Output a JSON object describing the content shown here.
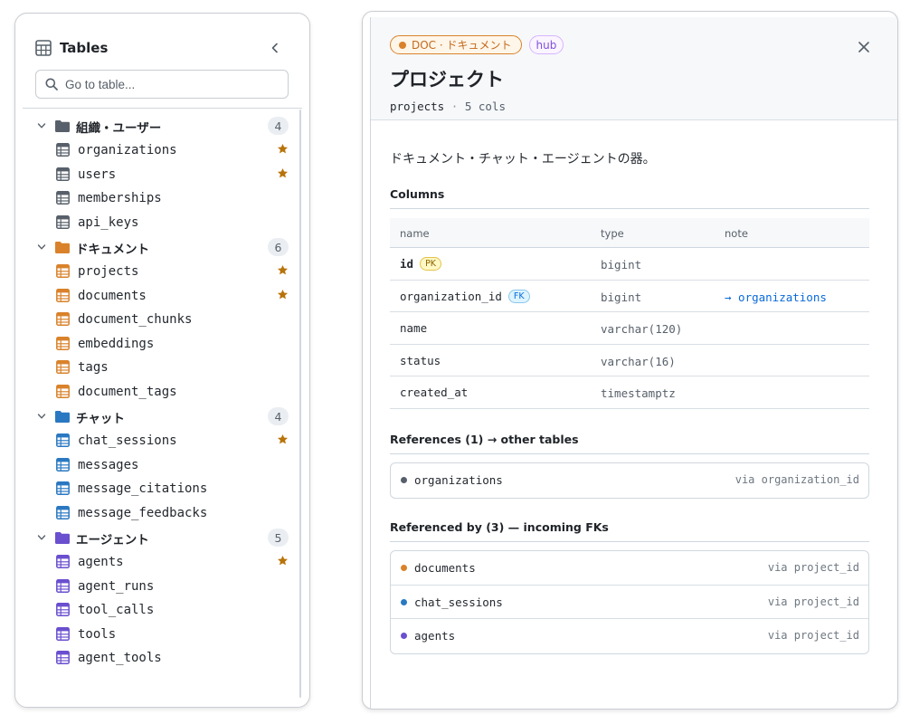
{
  "sidebar": {
    "title": "Tables",
    "search_placeholder": "Go to table...",
    "groups": [
      {
        "label": "組織・ユーザー",
        "count": "4",
        "color": "#57606a",
        "tables": [
          {
            "name": "organizations",
            "starred": true
          },
          {
            "name": "users",
            "starred": true
          },
          {
            "name": "memberships",
            "starred": false
          },
          {
            "name": "api_keys",
            "starred": false
          }
        ]
      },
      {
        "label": "ドキュメント",
        "count": "6",
        "color": "#d9822b",
        "tables": [
          {
            "name": "projects",
            "starred": true
          },
          {
            "name": "documents",
            "starred": true
          },
          {
            "name": "document_chunks",
            "starred": false
          },
          {
            "name": "embeddings",
            "starred": false
          },
          {
            "name": "tags",
            "starred": false
          },
          {
            "name": "document_tags",
            "starred": false
          }
        ]
      },
      {
        "label": "チャット",
        "count": "4",
        "color": "#2a78c2",
        "tables": [
          {
            "name": "chat_sessions",
            "starred": true
          },
          {
            "name": "messages",
            "starred": false
          },
          {
            "name": "message_citations",
            "starred": false
          },
          {
            "name": "message_feedbacks",
            "starred": false
          }
        ]
      },
      {
        "label": "エージェント",
        "count": "5",
        "color": "#6a4fcf",
        "tables": [
          {
            "name": "agents",
            "starred": true
          },
          {
            "name": "agent_runs",
            "starred": false
          },
          {
            "name": "tool_calls",
            "starred": false
          },
          {
            "name": "tools",
            "starred": false
          },
          {
            "name": "agent_tools",
            "starred": false
          }
        ]
      }
    ],
    "star_color": "#b8730a"
  },
  "detail": {
    "chip_doc": "DOC · ドキュメント",
    "chip_hub": "hub",
    "title": "プロジェクト",
    "table_name": "projects",
    "separator": "·",
    "cols_count": "5 cols",
    "description": "ドキュメント・チャット・エージェントの器。",
    "columns_title": "Columns",
    "col_headers": {
      "name": "name",
      "type": "type",
      "note": "note"
    },
    "columns": [
      {
        "name": "id",
        "key": "PK",
        "type": "bigint",
        "note": ""
      },
      {
        "name": "organization_id",
        "key": "FK",
        "type": "bigint",
        "note": "→ organizations"
      },
      {
        "name": "name",
        "key": "",
        "type": "varchar(120)",
        "note": ""
      },
      {
        "name": "status",
        "key": "",
        "type": "varchar(16)",
        "note": ""
      },
      {
        "name": "created_at",
        "key": "",
        "type": "timestamptz",
        "note": ""
      }
    ],
    "references_title": "References (1) → other tables",
    "references": [
      {
        "name": "organizations",
        "via": "via organization_id",
        "color": "#57606a"
      }
    ],
    "referenced_by_title": "Referenced by (3) — incoming FKs",
    "referenced_by": [
      {
        "name": "documents",
        "via": "via project_id",
        "color": "#d9822b"
      },
      {
        "name": "chat_sessions",
        "via": "via project_id",
        "color": "#2a78c2"
      },
      {
        "name": "agents",
        "via": "via project_id",
        "color": "#6a4fcf"
      }
    ]
  }
}
